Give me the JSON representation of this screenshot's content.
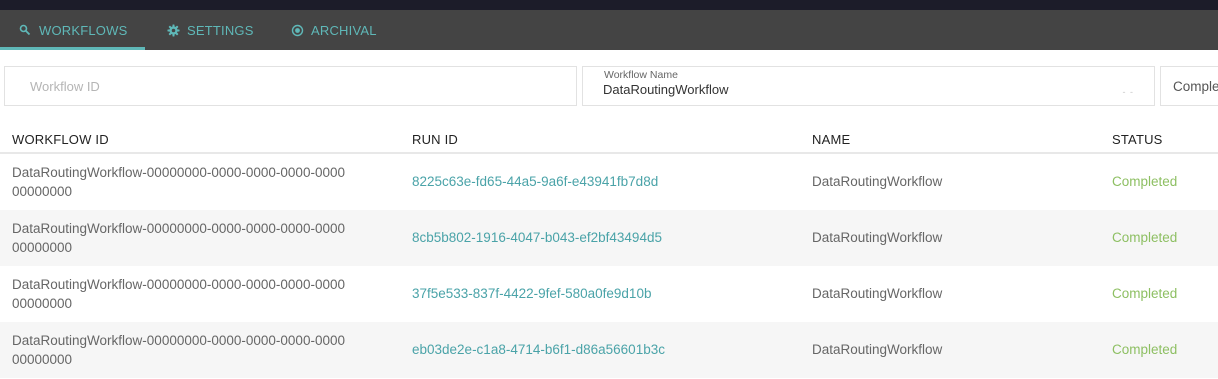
{
  "nav": {
    "tabs": [
      {
        "label": "WORKFLOWS",
        "icon": "search-icon",
        "active": true
      },
      {
        "label": "SETTINGS",
        "icon": "gear-icon",
        "active": false
      },
      {
        "label": "ARCHIVAL",
        "icon": "archive-icon",
        "active": false
      }
    ],
    "accent_color": "#5fb8b8"
  },
  "filters": {
    "workflow_id": {
      "placeholder": "Workflow ID",
      "value": ""
    },
    "workflow_name": {
      "label": "Workflow Name",
      "value": "DataRoutingWorkflow"
    },
    "status": {
      "value": "Comple"
    }
  },
  "table": {
    "columns": [
      "WORKFLOW ID",
      "RUN ID",
      "NAME",
      "STATUS"
    ],
    "rows": [
      {
        "workflow_id": "DataRoutingWorkflow-00000000-0000-0000-0000-000000000000",
        "run_id": "8225c63e-fd65-44a5-9a6f-e43941fb7d8d",
        "name": "DataRoutingWorkflow",
        "status": "Completed"
      },
      {
        "workflow_id": "DataRoutingWorkflow-00000000-0000-0000-0000-000000000000",
        "run_id": "8cb5b802-1916-4047-b043-ef2bf43494d5",
        "name": "DataRoutingWorkflow",
        "status": "Completed"
      },
      {
        "workflow_id": "DataRoutingWorkflow-00000000-0000-0000-0000-000000000000",
        "run_id": "37f5e533-837f-4422-9fef-580a0fe9d10b",
        "name": "DataRoutingWorkflow",
        "status": "Completed"
      },
      {
        "workflow_id": "DataRoutingWorkflow-00000000-0000-0000-0000-000000000000",
        "run_id": "eb03de2e-c1a8-4714-b6f1-d86a56601b3c",
        "name": "DataRoutingWorkflow",
        "status": "Completed"
      }
    ],
    "status_color": "#8dbf62",
    "link_color": "#4aa3a8"
  }
}
